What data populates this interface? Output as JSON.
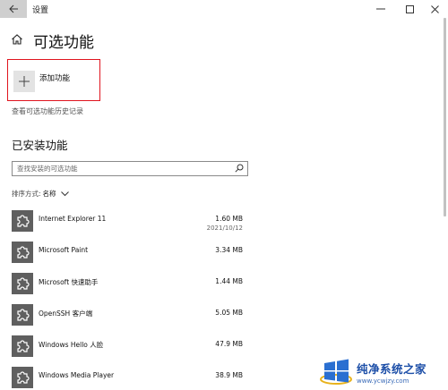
{
  "window": {
    "title": "设置",
    "back_icon": "arrow-left-icon",
    "controls": [
      "minimize-icon",
      "maximize-icon",
      "close-icon"
    ]
  },
  "header": {
    "home_icon": "home-icon",
    "title": "可选功能"
  },
  "add_feature": {
    "icon": "plus-icon",
    "label": "添加功能",
    "highlight_color": "#e0141e"
  },
  "history_link": "查看可选功能历史记录",
  "installed": {
    "title": "已安装功能",
    "search": {
      "placeholder": "查找安装的可选功能",
      "icon": "search-icon"
    },
    "sort": {
      "label": "排序方式:",
      "value": "名称",
      "icon": "chevron-down-icon"
    },
    "features": [
      {
        "name": "Internet Explorer 11",
        "size": "1.60 MB",
        "date": "2021/10/12"
      },
      {
        "name": "Microsoft Paint",
        "size": "3.34 MB",
        "date": ""
      },
      {
        "name": "Microsoft 快速助手",
        "size": "1.44 MB",
        "date": ""
      },
      {
        "name": "OpenSSH 客户端",
        "size": "5.05 MB",
        "date": ""
      },
      {
        "name": "Windows Hello 人脸",
        "size": "47.9 MB",
        "date": ""
      },
      {
        "name": "Windows Media Player",
        "size": "38.9 MB",
        "date": ""
      }
    ]
  },
  "watermark": {
    "title": "纯净系统之家",
    "url": "www.ycwjzy.com"
  }
}
